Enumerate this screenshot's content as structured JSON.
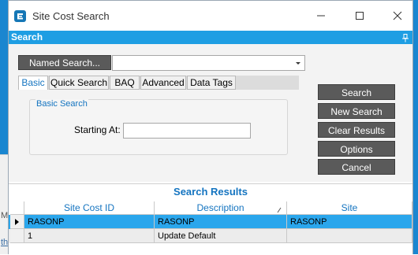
{
  "window": {
    "title": "Site Cost Search",
    "icon": "epicor-e-icon"
  },
  "search_panel": {
    "title": "Search",
    "named_search_label": "Named Search...",
    "named_search_value": "",
    "tabs": [
      {
        "label": "Basic",
        "active": true
      },
      {
        "label": "Quick Search",
        "active": false
      },
      {
        "label": "BAQ",
        "active": false
      },
      {
        "label": "Advanced",
        "active": false
      },
      {
        "label": "Data Tags",
        "active": false
      }
    ],
    "basic": {
      "group_title": "Basic Search",
      "starting_at_label": "Starting At:",
      "starting_at_value": ""
    }
  },
  "actions": {
    "search": "Search",
    "new_search": "New Search",
    "clear_results": "Clear Results",
    "options": "Options",
    "cancel": "Cancel"
  },
  "results": {
    "title": "Search Results",
    "columns": [
      "Site Cost ID",
      "Description",
      "Site"
    ],
    "rows": [
      {
        "site_cost_id": "RASONP",
        "description": "RASONP",
        "site": "RASONP",
        "selected": true
      },
      {
        "site_cost_id": "1",
        "description": "Update Default",
        "site": "",
        "selected": false
      }
    ]
  },
  "background": {
    "m": "M",
    "th": "th"
  },
  "colors": {
    "accent": "#1e9ee3",
    "selected_row": "#2aa6ec",
    "button": "#5a5a5a",
    "link_text": "#1474c0"
  }
}
